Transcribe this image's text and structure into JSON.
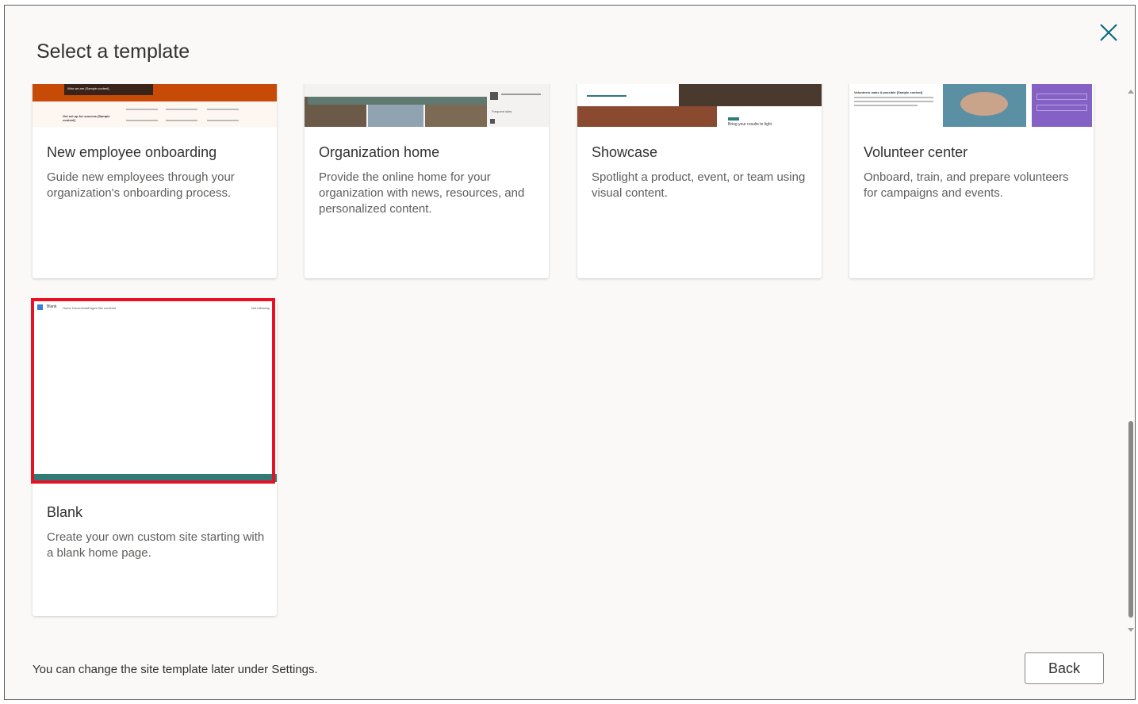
{
  "dialog": {
    "title": "Select a template",
    "close_label": "Close",
    "footer_note": "You can change the site template later under Settings.",
    "back_label": "Back"
  },
  "templates": [
    {
      "title": "New employee onboarding",
      "description": "Guide new employees through your organization's onboarding process.",
      "preview_text": [
        "Who we are [Sample content]",
        "Get set up for success [Sample content]"
      ]
    },
    {
      "title": "Organization home",
      "description": "Provide the online home for your organization with news, resources, and personalized content.",
      "preview_text": [
        "Frequent sites"
      ]
    },
    {
      "title": "Showcase",
      "description": "Spotlight a product, event, or team using visual content.",
      "preview_text": [
        "Bring your results to light"
      ]
    },
    {
      "title": "Volunteer center",
      "description": "Onboard, train, and prepare volunteers for campaigns and events.",
      "preview_text": [
        "Volunteers make it possible [Sample content]"
      ]
    },
    {
      "title": "Blank",
      "description": "Create your own custom site starting with a blank home page.",
      "selected": true,
      "preview_text": [
        "Blank",
        "Home",
        "Documents",
        "Pages",
        "Site contents",
        "Not following"
      ]
    }
  ],
  "colors": {
    "accent_teal": "#2e7b78",
    "selection_red": "#e81123",
    "onboarding_orange": "#c74b06",
    "volunteer_purple": "#8661c5"
  }
}
